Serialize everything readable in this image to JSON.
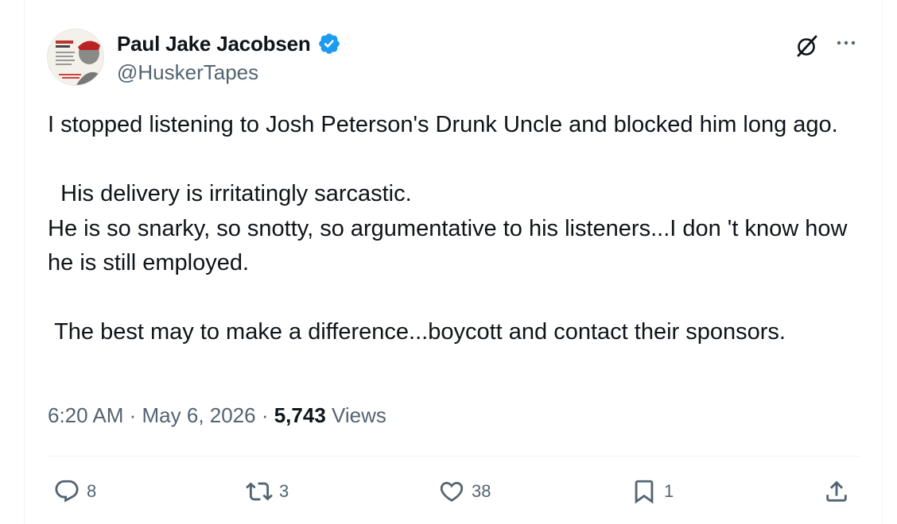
{
  "author": {
    "display_name": "Paul Jake Jacobsen",
    "handle": "@HuskerTapes",
    "verified": true,
    "verified_color": "#1d9bf0"
  },
  "post": {
    "paragraphs": [
      "I stopped listening to Josh Peterson's Drunk Uncle and blocked him long ago.",
      "  His delivery is irritatingly sarcastic.\nHe is so snarky, so snotty, so argumentative to his listeners...I don 't know how he is still employed.",
      " The best may to make a difference...boycott and contact their sponsors."
    ],
    "time": "6:20 AM",
    "separator": " · ",
    "date": "May 6, 2026",
    "views_count": "5,743",
    "views_label": " Views"
  },
  "actions": {
    "reply": {
      "icon": "reply-icon",
      "count": "8"
    },
    "repost": {
      "icon": "repost-icon",
      "count": "3"
    },
    "like": {
      "icon": "heart-icon",
      "count": "38"
    },
    "bookmark": {
      "icon": "bookmark-icon",
      "count": "1"
    },
    "share": {
      "icon": "share-icon",
      "count": ""
    }
  },
  "header_icons": [
    "grok-icon",
    "more-icon"
  ],
  "colors": {
    "text": "#0f1419",
    "muted": "#536471",
    "border": "#eff3f4"
  }
}
